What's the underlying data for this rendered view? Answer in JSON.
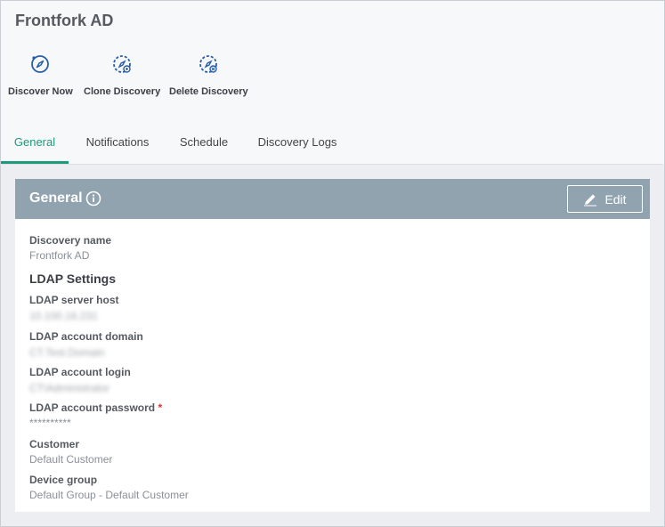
{
  "header": {
    "title": "Frontfork AD"
  },
  "toolbar": {
    "discover_now": {
      "label": "Discover Now",
      "icon": "compass-icon"
    },
    "clone_discovery": {
      "label": "Clone Discovery",
      "icon": "clone-discovery-icon"
    },
    "delete_discovery": {
      "label": "Delete Discovery",
      "icon": "delete-discovery-icon"
    }
  },
  "tabs": [
    {
      "label": "General",
      "active": true
    },
    {
      "label": "Notifications",
      "active": false
    },
    {
      "label": "Schedule",
      "active": false
    },
    {
      "label": "Discovery Logs",
      "active": false
    }
  ],
  "panel": {
    "title": "General",
    "edit_label": "Edit",
    "discovery_name_label": "Discovery name",
    "discovery_name_value": "Frontfork AD",
    "ldap_section_title": "LDAP Settings",
    "ldap_host_label": "LDAP server host",
    "ldap_host_value": "10.100.16.231",
    "ldap_domain_label": "LDAP account domain",
    "ldap_domain_value": "CT.Test.Domain",
    "ldap_login_label": "LDAP account login",
    "ldap_login_value": "CT\\Administrator",
    "ldap_password_label": "LDAP account password",
    "required_marker": "*",
    "ldap_password_value": "**********",
    "customer_label": "Customer",
    "customer_value": "Default Customer",
    "device_group_label": "Device group",
    "device_group_value": "Default Group - Default Customer"
  },
  "colors": {
    "accent": "#1b9b7a",
    "panel_header": "#92a3b0",
    "icon_blue": "#2a5ea8",
    "required": "#e0302f"
  }
}
